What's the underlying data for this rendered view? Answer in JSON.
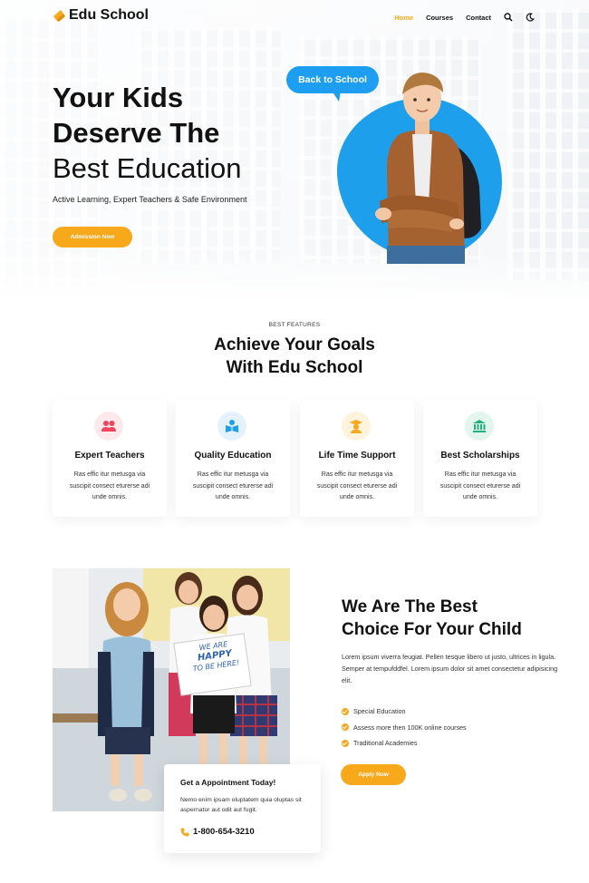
{
  "nav": {
    "brand": "Edu School",
    "links": [
      "Home",
      "Courses",
      "Contact"
    ],
    "active_color": "#f7a81b"
  },
  "hero": {
    "title_line1": "Your Kids",
    "title_line2": "Deserve The",
    "title_line3": "Best Education",
    "subtitle": "Active Learning, Expert Teachers & Safe Environment",
    "cta": "Admission Now",
    "badge": "Back to School"
  },
  "features": {
    "label": "BEST FEATURES",
    "title_line1": "Achieve Your Goals",
    "title_line2": "With Edu School",
    "cards": [
      {
        "title": "Expert Teachers",
        "text": "Ras effic itur metusga via suscipit consect eturerse adi unde omnis.",
        "icon": "teachers-icon",
        "color": "#f0445d"
      },
      {
        "title": "Quality Education",
        "text": "Ras effic itur metusga via suscipit consect eturerse adi unde omnis.",
        "icon": "book-icon",
        "color": "#1e9fec"
      },
      {
        "title": "Life Time Support",
        "text": "Ras effic itur metusga via suscipit consect eturerse adi unde omnis.",
        "icon": "graduate-icon",
        "color": "#f7a81b"
      },
      {
        "title": "Best Scholarships",
        "text": "Ras effic itur metusga via suscipit consect eturerse adi unde omnis.",
        "icon": "institution-icon",
        "color": "#22b07d"
      }
    ]
  },
  "photo": {
    "sign_line1": "WE ARE",
    "sign_line2": "HAPPY",
    "sign_line3": "TO BE HERE!"
  },
  "about": {
    "title_line1": "We Are The Best",
    "title_line2": "Choice For Your Child",
    "text": "Lorem ipsum viverra feugiat. Pellen tesque libero ut justo, ultrices in ligula. Semper at tempufddfel. Lorem ipsum dolor sit amet consectetur adipisicing elit.",
    "checks": [
      "Special Education",
      "Assess more then 100K online courses",
      "Traditional Academies"
    ],
    "cta": "Apply Now"
  },
  "appointment": {
    "title": "Get a Appointment Today!",
    "text": "Nemo enim ipsam oluptatem quia oluptas sit aspernatur aut odit aut fugit.",
    "phone": "1-800-654-3210"
  }
}
